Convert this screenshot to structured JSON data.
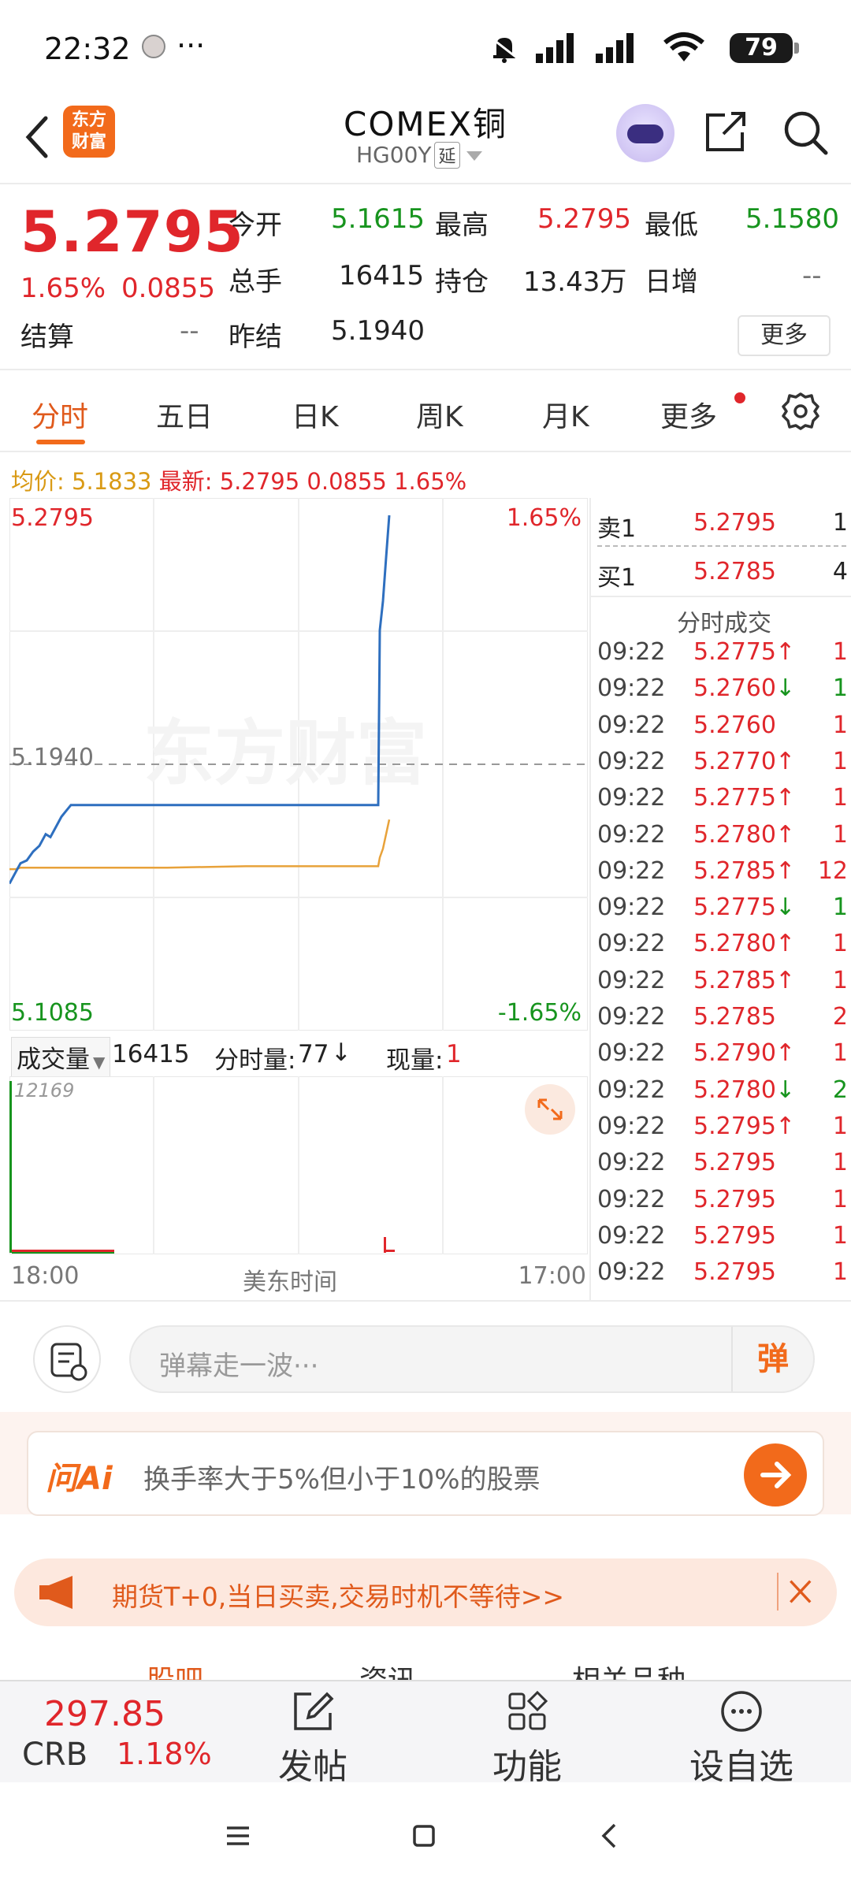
{
  "status_bar": {
    "time": "22:32",
    "more": "···",
    "battery": "79"
  },
  "header": {
    "logo_line1": "东方",
    "logo_line2": "财富",
    "title": "COMEX铜",
    "code": "HG00Y",
    "delay_tag": "延"
  },
  "quote": {
    "price": "5.2795",
    "change_pct": "1.65%",
    "change": "0.0855",
    "open_label": "今开",
    "open": "5.1615",
    "high_label": "最高",
    "high": "5.2795",
    "low_label": "最低",
    "low": "5.1580",
    "volume_label": "总手",
    "volume": "16415",
    "oi_label": "持仓",
    "oi": "13.43万",
    "daily_inc_label": "日增",
    "daily_inc": "--",
    "settle_label": "结算",
    "settle": "--",
    "prev_settle_label": "昨结",
    "prev_settle": "5.1940",
    "more_button": "更多"
  },
  "tabs": [
    "分时",
    "五日",
    "日K",
    "周K",
    "月K",
    "更多"
  ],
  "info_line": {
    "avg_label": "均价:",
    "avg": "5.1833",
    "latest_label": "最新:",
    "latest": "5.2795",
    "change": "0.0855",
    "change_pct": "1.65%"
  },
  "chart": {
    "top_price": "5.2795",
    "top_pct": "1.65%",
    "mid_price": "5.1940",
    "bottom_price": "5.1085",
    "bottom_pct": "-1.65%",
    "watermark": "东方财富"
  },
  "chart_data": {
    "type": "line",
    "ylim": [
      5.1085,
      5.2795
    ],
    "reference": 5.194,
    "series": [
      {
        "values": [
          5.153,
          5.157,
          5.16,
          5.161,
          5.164,
          5.166,
          5.17,
          5.169,
          5.173,
          5.176,
          5.178,
          5.18,
          5.18,
          5.18,
          5.18,
          5.18,
          5.18,
          5.24,
          5.25,
          5.265,
          5.2795
        ]
      },
      {
        "values": [
          5.158,
          5.158,
          5.1585,
          5.1585,
          5.1585,
          5.1585,
          5.1585,
          5.1585,
          5.1585,
          5.1585,
          5.1585,
          5.1585,
          5.1585,
          5.1585,
          5.159,
          5.159,
          5.159,
          5.162,
          5.165,
          5.17,
          5.175
        ]
      }
    ]
  },
  "order_book": {
    "sell_label": "卖1",
    "sell_price": "5.2795",
    "sell_qty": "1",
    "buy_label": "买1",
    "buy_price": "5.2785",
    "buy_qty": "4",
    "trades_title": "分时成交",
    "trades": [
      {
        "time": "09:22",
        "price": "5.2775",
        "dir": "↑",
        "qty": "1",
        "color": "#e0262b"
      },
      {
        "time": "09:22",
        "price": "5.2760",
        "dir": "↓",
        "qty": "1",
        "color": "#e0262b"
      },
      {
        "time": "09:22",
        "price": "5.2760",
        "dir": "",
        "qty": "1",
        "color": "#e0262b"
      },
      {
        "time": "09:22",
        "price": "5.2770",
        "dir": "↑",
        "qty": "1",
        "color": "#e0262b"
      },
      {
        "time": "09:22",
        "price": "5.2775",
        "dir": "↑",
        "qty": "1",
        "color": "#e0262b"
      },
      {
        "time": "09:22",
        "price": "5.2780",
        "dir": "↑",
        "qty": "1",
        "color": "#e0262b"
      },
      {
        "time": "09:22",
        "price": "5.2785",
        "dir": "↑",
        "qty": "12",
        "color": "#e0262b"
      },
      {
        "time": "09:22",
        "price": "5.2775",
        "dir": "↓",
        "qty": "1",
        "color": "#e0262b"
      },
      {
        "time": "09:22",
        "price": "5.2780",
        "dir": "↑",
        "qty": "1",
        "color": "#e0262b"
      },
      {
        "time": "09:22",
        "price": "5.2785",
        "dir": "↑",
        "qty": "1",
        "color": "#e0262b"
      },
      {
        "time": "09:22",
        "price": "5.2785",
        "dir": "",
        "qty": "2",
        "color": "#e0262b"
      },
      {
        "time": "09:22",
        "price": "5.2790",
        "dir": "↑",
        "qty": "1",
        "color": "#e0262b"
      },
      {
        "time": "09:22",
        "price": "5.2780",
        "dir": "↓",
        "qty": "2",
        "color": "#e0262b"
      },
      {
        "time": "09:22",
        "price": "5.2795",
        "dir": "↑",
        "qty": "1",
        "color": "#e0262b"
      },
      {
        "time": "09:22",
        "price": "5.2795",
        "dir": "",
        "qty": "1",
        "color": "#e0262b"
      },
      {
        "time": "09:22",
        "price": "5.2795",
        "dir": "",
        "qty": "1",
        "color": "#e0262b"
      },
      {
        "time": "09:22",
        "price": "5.2795",
        "dir": "",
        "qty": "1",
        "color": "#e0262b"
      },
      {
        "time": "09:22",
        "price": "5.2795",
        "dir": "",
        "qty": "1",
        "color": "#e0262b"
      }
    ]
  },
  "volume": {
    "select_label": "成交量",
    "total": "16415",
    "minute_label": "分时量:",
    "minute_value": "77",
    "current_label": "现量:",
    "current_value": "1",
    "max": "12169"
  },
  "time_axis": {
    "start": "18:00",
    "middle": "美东时间",
    "end": "17:00"
  },
  "danmu": {
    "placeholder": "弹幕走一波···",
    "button": "弹"
  },
  "ai": {
    "logo": "问Ai",
    "prompt": "换手率大于5%但小于10%的股票"
  },
  "promo": {
    "text": "期货T+0,当日买卖,交易时机不等待>>"
  },
  "cut_tabs": [
    "股吧",
    "资讯",
    "相关品种"
  ],
  "bottom_bar": {
    "crb_value": "297.85",
    "crb_name": "CRB",
    "crb_pct": "1.18%",
    "post": "发帖",
    "func": "功能",
    "watch": "设自选"
  }
}
